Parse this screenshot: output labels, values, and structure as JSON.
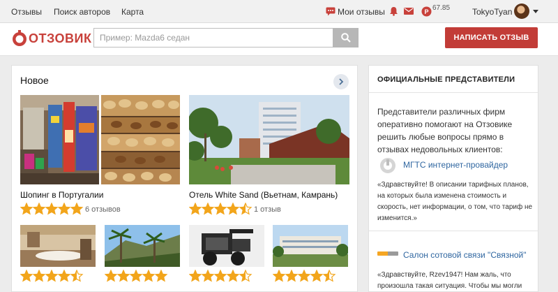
{
  "nav": {
    "links": [
      "Отзывы",
      "Поиск авторов",
      "Карта"
    ],
    "my_reviews": "Мои отзывы",
    "points": "67.85",
    "username": "TokyoTyan"
  },
  "header": {
    "logo": "ОТЗОВИК",
    "search_placeholder": "Пример: Mazda6 седан",
    "write_button": "НАПИСАТЬ ОТЗЫВ"
  },
  "new_section": {
    "title": "Новое",
    "featured": [
      {
        "caption": "Шопинг в Португалии",
        "rating": 5,
        "reviews": "6 отзывов"
      },
      {
        "caption": "Отель White Sand (Вьетнам, Камрань)",
        "rating": 4.5,
        "reviews": "1 отзыв"
      }
    ],
    "small": [
      {
        "subject": "restaurant interior",
        "rating": 4.5
      },
      {
        "subject": "palm trees and mountains",
        "rating": 5
      },
      {
        "subject": "snow blower",
        "rating": 4.5
      },
      {
        "subject": "hotel exterior",
        "rating": 4.5
      }
    ]
  },
  "sidebar": {
    "title": "ОФИЦИАЛЬНЫЕ ПРЕДСТАВИТЕЛИ",
    "description": "Представители различных фирм оперативно помогают на Отзовике решить любые вопросы прямо в отзывах недовольных клиентов:",
    "reps": [
      {
        "name": "МГТС интернет-провайдер",
        "quote": "«Здравствуйте! В описании тарифных планов, на которых была изменена стоимость и скорость, нет информации, о том, что тариф не изменится.»"
      },
      {
        "name": "Салон сотовой связи \"Связной\"",
        "quote": "«Здравствуйте, Rzev1947! Нам жаль, что произошла такая ситуация. Чтобы мы могли"
      }
    ]
  },
  "colors": {
    "brand": "#c23c37",
    "star": "#f2a51b",
    "link": "#2f66a0"
  }
}
